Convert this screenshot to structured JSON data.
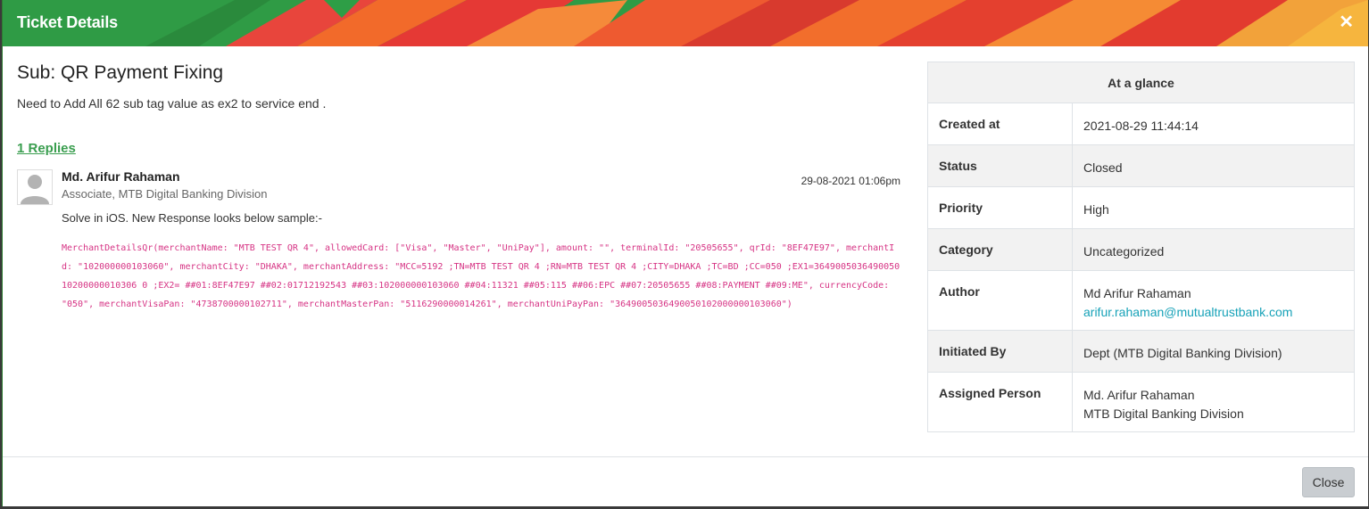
{
  "modal": {
    "title": "Ticket Details",
    "close_icon": "close-x-icon",
    "colors": {
      "header_green": "#2f9b45",
      "accent_red": "#e53935",
      "accent_orange": "#f57c20",
      "link_green": "#3a9e4f",
      "code_pink": "#d63384"
    }
  },
  "ticket": {
    "subject": "Sub: QR Payment Fixing",
    "description": "Need to Add All 62 sub tag value as ex2 to service end ."
  },
  "replies": {
    "count_label": "1 Replies",
    "items": [
      {
        "avatar_icon": "user-avatar-icon",
        "author": "Md. Arifur Rahaman",
        "role": "Associate, MTB Digital Banking Division",
        "date": "29-08-2021 01:06pm",
        "text": "Solve in iOS. New Response looks below sample:-",
        "code": "MerchantDetailsQr(merchantName: \"MTB TEST QR 4\", allowedCard: [\"Visa\", \"Master\", \"UniPay\"], amount: \"\", terminalId: \"20505655\", qrId: \"8EF47E97\", merchantId: \"102000000103060\", merchantCity: \"DHAKA\", merchantAddress: \"MCC=5192 ;TN=MTB TEST QR 4 ;RN=MTB TEST QR 4 ;CITY=DHAKA ;TC=BD ;CC=050 ;EX1=364900503649005010200000010306 0 ;EX2= ##01:8EF47E97 ##02:01712192543 ##03:102000000103060 ##04:11321 ##05:115 ##06:EPC ##07:20505655 ##08:PAYMENT ##09:ME\", currencyCode: \"050\", merchantVisaPan: \"4738700000102711\", merchantMasterPan: \"5116290000014261\", merchantUniPayPan: \"3649005036490050102000000103060\")"
      }
    ]
  },
  "glance": {
    "heading": "At a glance",
    "rows": [
      {
        "label": "Created at",
        "value": "2021-08-29 11:44:14"
      },
      {
        "label": "Status",
        "value": "Closed"
      },
      {
        "label": "Priority",
        "value": "High"
      },
      {
        "label": "Category",
        "value": "Uncategorized"
      },
      {
        "label": "Author",
        "value": "Md Arifur Rahaman",
        "value2": "arifur.rahaman@mutualtrustbank.com"
      },
      {
        "label": "Initiated By",
        "value": "Dept (MTB Digital Banking Division)"
      },
      {
        "label": "Assigned Person",
        "value": "Md. Arifur Rahaman",
        "value2": "MTB Digital Banking Division"
      }
    ]
  },
  "footer": {
    "close_label": "Close"
  }
}
